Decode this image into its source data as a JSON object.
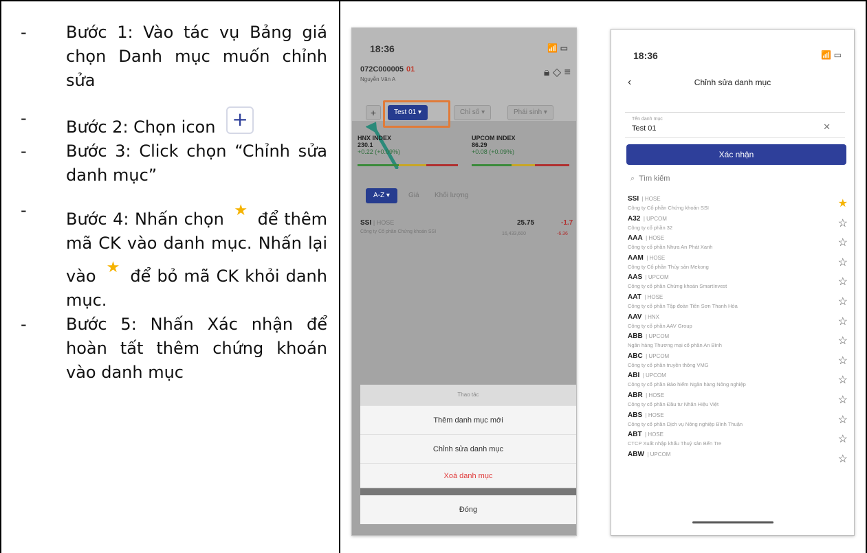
{
  "instructions": {
    "dash": "-",
    "step1": "Bước 1: Vào tác vụ Bảng giá chọn Danh mục muốn chỉnh sửa",
    "step2": "Bước 2: Chọn icon",
    "step2_icon": "plus-icon",
    "step3": "Bước 3: Click chọn “Chỉnh sửa danh mục”",
    "step4a": "Bước 4: Nhấn chọn",
    "step4b": "để thêm mã CK vào danh mục. Nhấn lại vào",
    "step4c": "để bỏ mã CK khỏi danh mục.",
    "step5": "Bước 5: Nhấn Xác nhận để hoàn tất thêm chứng khoán vào danh mục",
    "star_color": "#f5b301"
  },
  "phone1": {
    "time": "18:36",
    "account": "072C000005",
    "account_suffix": "01",
    "user_name": "Nguyễn Văn A",
    "chips": [
      "+",
      "Test 01",
      "Chỉ số",
      "Phái sinh"
    ],
    "indices": [
      {
        "name": "HNX INDEX",
        "value": "230.1",
        "change": "+0.22 (+0.09%)"
      },
      {
        "name": "UPCOM INDEX",
        "value": "86.29",
        "change": "+0.08 (+0.09%)"
      }
    ],
    "sort_tabs": [
      "A-Z",
      "Giá",
      "Khối lượng"
    ],
    "row": {
      "symbol": "SSI",
      "exchange": "| HOSE",
      "company": "Công ty Cổ phần Chứng khoán SSI",
      "price": "25.75",
      "change": "-1.7",
      "volume": "16,433,600",
      "change_pct": "-6.36"
    },
    "sheet": {
      "title": "Thao tác",
      "items": [
        "Thêm danh mục mới",
        "Chỉnh sửa danh mục",
        "Xoá danh mục"
      ],
      "close": "Đóng"
    },
    "accent": "#263c8f",
    "highlight": "#e07b39"
  },
  "phone2": {
    "time": "18:36",
    "title": "Chỉnh sửa danh mục",
    "field_label": "Tên danh mục",
    "field_value": "Test 01",
    "confirm": "Xác nhận",
    "search_placeholder": "Tìm kiếm",
    "accent": "#2e3f9a",
    "items": [
      {
        "sym": "SSI",
        "ex": "| HOSE",
        "name": "Công ty Cổ phần Chứng khoán SSI",
        "starred": true
      },
      {
        "sym": "A32",
        "ex": "| UPCOM",
        "name": "Công ty cổ phần 32",
        "starred": false
      },
      {
        "sym": "AAA",
        "ex": "| HOSE",
        "name": "Công ty cổ phần Nhựa An Phát Xanh",
        "starred": false
      },
      {
        "sym": "AAM",
        "ex": "| HOSE",
        "name": "Công ty Cổ phần Thủy sản Mekong",
        "starred": false
      },
      {
        "sym": "AAS",
        "ex": "| UPCOM",
        "name": "Công ty cổ phần Chứng khoán SmartInvest",
        "starred": false
      },
      {
        "sym": "AAT",
        "ex": "| HOSE",
        "name": "Công ty cổ phần Tập đoàn Tiên Sơn Thanh Hóa",
        "starred": false
      },
      {
        "sym": "AAV",
        "ex": "| HNX",
        "name": "Công ty cổ phần AAV Group",
        "starred": false
      },
      {
        "sym": "ABB",
        "ex": "| UPCOM",
        "name": "Ngân hàng Thương mại cổ phần An Bình",
        "starred": false
      },
      {
        "sym": "ABC",
        "ex": "| UPCOM",
        "name": "Công ty cổ phần truyền thông VMG",
        "starred": false
      },
      {
        "sym": "ABI",
        "ex": "| UPCOM",
        "name": "Công ty cổ phần Bảo hiểm Ngân hàng Nông nghiệp",
        "starred": false
      },
      {
        "sym": "ABR",
        "ex": "| HOSE",
        "name": "Công ty cổ phần Đầu tư Nhãn Hiệu Việt",
        "starred": false
      },
      {
        "sym": "ABS",
        "ex": "| HOSE",
        "name": "Công ty cổ phần Dịch vụ Nông nghiệp Bình Thuận",
        "starred": false
      },
      {
        "sym": "ABT",
        "ex": "| HOSE",
        "name": "CTCP Xuất nhập khẩu Thuỷ sản Bến Tre",
        "starred": false
      },
      {
        "sym": "ABW",
        "ex": "| UPCOM",
        "name": "",
        "starred": false
      }
    ]
  }
}
